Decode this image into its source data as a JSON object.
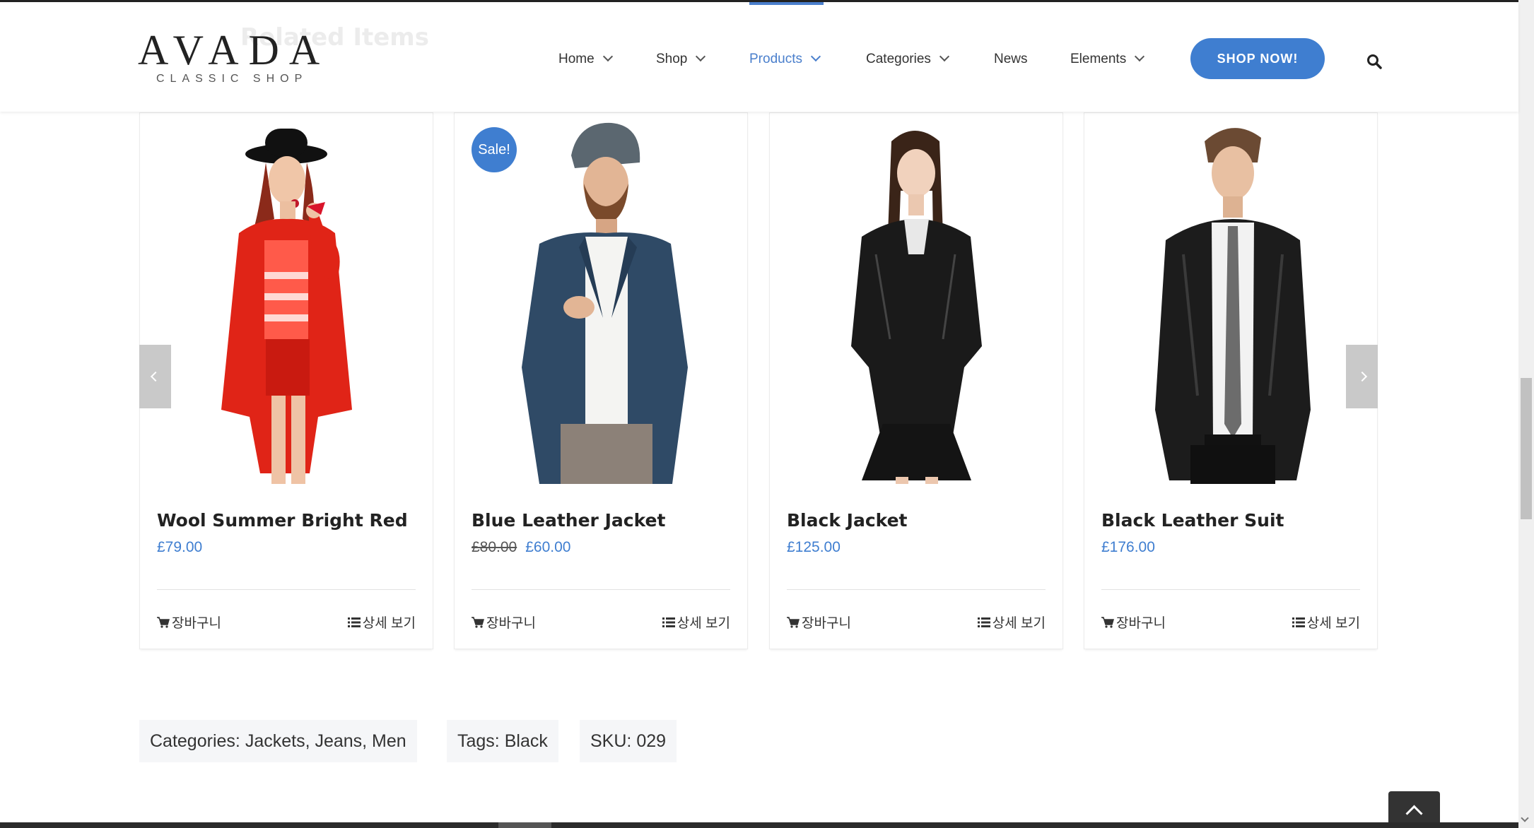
{
  "header": {
    "ghost_title": "Related Items",
    "logo": {
      "main": "AVADA",
      "sub": "CLASSIC SHOP"
    },
    "nav": [
      {
        "label": "Home",
        "dropdown": true,
        "active": false
      },
      {
        "label": "Shop",
        "dropdown": true,
        "active": false
      },
      {
        "label": "Products",
        "dropdown": true,
        "active": true
      },
      {
        "label": "Categories",
        "dropdown": true,
        "active": false
      },
      {
        "label": "News",
        "dropdown": false,
        "active": false
      },
      {
        "label": "Elements",
        "dropdown": true,
        "active": false
      }
    ],
    "cta_label": "SHOP NOW!",
    "search_icon": "search-icon"
  },
  "products": [
    {
      "name": "Wool Summer Bright Red",
      "price": "£79.00",
      "old_price": "",
      "sale": false,
      "cart_label": "장바구니",
      "details_label": "상세 보기"
    },
    {
      "name": "Blue Leather Jacket",
      "price": "£60.00",
      "old_price": "£80.00",
      "sale": true,
      "sale_label": "Sale!",
      "cart_label": "장바구니",
      "details_label": "상세 보기"
    },
    {
      "name": "Black Jacket",
      "price": "£125.00",
      "old_price": "",
      "sale": false,
      "cart_label": "장바구니",
      "details_label": "상세 보기"
    },
    {
      "name": "Black Leather Suit",
      "price": "£176.00",
      "old_price": "",
      "sale": false,
      "cart_label": "장바구니",
      "details_label": "상세 보기"
    }
  ],
  "meta": {
    "categories_label": "Categories:",
    "categories": "Jackets, Jeans, Men",
    "tags_label": "Tags:",
    "tags": "Black",
    "sku_label": "SKU:",
    "sku": "029"
  },
  "colors": {
    "accent": "#3f7ed0",
    "text": "#333333"
  }
}
